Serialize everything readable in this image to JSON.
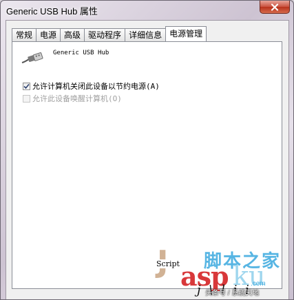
{
  "window": {
    "title": "Generic USB Hub 属性"
  },
  "tabs": [
    {
      "label": "常规",
      "active": false
    },
    {
      "label": "电源",
      "active": false
    },
    {
      "label": "高级",
      "active": false
    },
    {
      "label": "驱动程序",
      "active": false
    },
    {
      "label": "详细信息",
      "active": false
    },
    {
      "label": "电源管理",
      "active": true
    }
  ],
  "device": {
    "name": "Generic USB Hub",
    "icon": "usb-plug-icon"
  },
  "options": [
    {
      "label": "允许计算机关闭此设备以节约电源(A)",
      "checked": true,
      "enabled": true
    },
    {
      "label": "允许此设备唤醒计算机(O)",
      "checked": false,
      "enabled": false
    }
  ],
  "footer": {
    "script_label": "Script"
  },
  "watermark": {
    "big_letter": "J",
    "asp": "asp",
    "ku": "ku",
    "chinese": "脚本之家",
    "url": ".com",
    "credit": "头条号 / 系统天地",
    "strokes": "j \\ l i i"
  },
  "colors": {
    "title_bar_tint": "#cdc3d2",
    "close_button": "#c9503d",
    "panel_bg": "#ffffff",
    "disabled_text": "#a0a0a0"
  }
}
